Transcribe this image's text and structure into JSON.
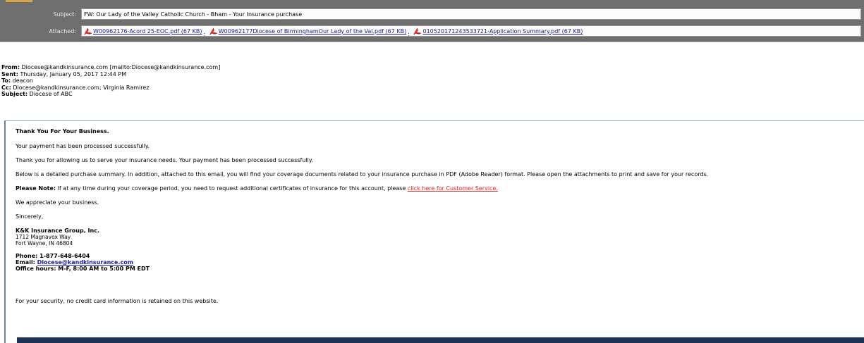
{
  "header": {
    "subject_label": "Subject:",
    "subject_value": "FW: Our Lady of the Valley Catholic Church - Bham - Your Insurance purchase",
    "attached_label": "Attached:",
    "attachments": [
      {
        "name": "W00962176-Acord 25-EOC.pdf (67 KB)",
        "icon": "pdf-icon"
      },
      {
        "name": "W00962177Diocese of BirminghamOur Lady of the Val.pdf (67 KB)",
        "icon": "pdf-icon"
      },
      {
        "name": "010520171243533721-Application Summary.pdf (67 KB)",
        "icon": "pdf-icon"
      }
    ],
    "separator": ";"
  },
  "meta": {
    "from_label": "From:",
    "from_value": "Diocese@kandkinsurance.com [mailto:Diocese@kandkinsurance.com]",
    "sent_label": "Sent:",
    "sent_value": "Thursday, January 05, 2017 12:44 PM",
    "to_label": "To:",
    "to_value": "deacon",
    "cc_label": "Cc:",
    "cc_value": "Diocese@kandkinsurance.com; Virginia Ramirez",
    "subject_label": "Subject:",
    "subject_value": "Diocese of ABC"
  },
  "body": {
    "heading": "Thank You For Your Business.",
    "p1": "Your payment has been processed successfully.",
    "p2": "Thank you for allowing us to serve your insurance needs. Your payment has been processed successfully.",
    "p3": "Below is a detailed purchase summary. In addition, attached to this email, you will find your coverage documents related to your insurance purchase in PDF (Adobe Reader) format. Please open the attachments to print and save for your records.",
    "note_label": "Please Note:",
    "note_text": " If at any time during your coverage period, you need to request additional certificates of insurance for this account, please ",
    "note_link": "click here for Customer Service.",
    "appreciate": "We appreciate your business.",
    "sincerely": "Sincerely,",
    "company": "K&K Insurance Group, Inc.",
    "address1": "1712 Magnavox Way",
    "address2": "Fort Wayne, IN 46804",
    "phone": "Phone: 1-877-648-6404",
    "email_label": "Email: ",
    "email_link": "Diocese@kandkinsurance.com",
    "hours": "Office hours: M-F, 8:00 AM to 5:00 PM EDT",
    "security": "For your security, no credit card information is retained on this website."
  },
  "colors": {
    "header_band": "#6f6f6f",
    "footer_bar": "#1e3457",
    "link_red": "#e0201c",
    "link_blue": "#1a1aa8"
  }
}
